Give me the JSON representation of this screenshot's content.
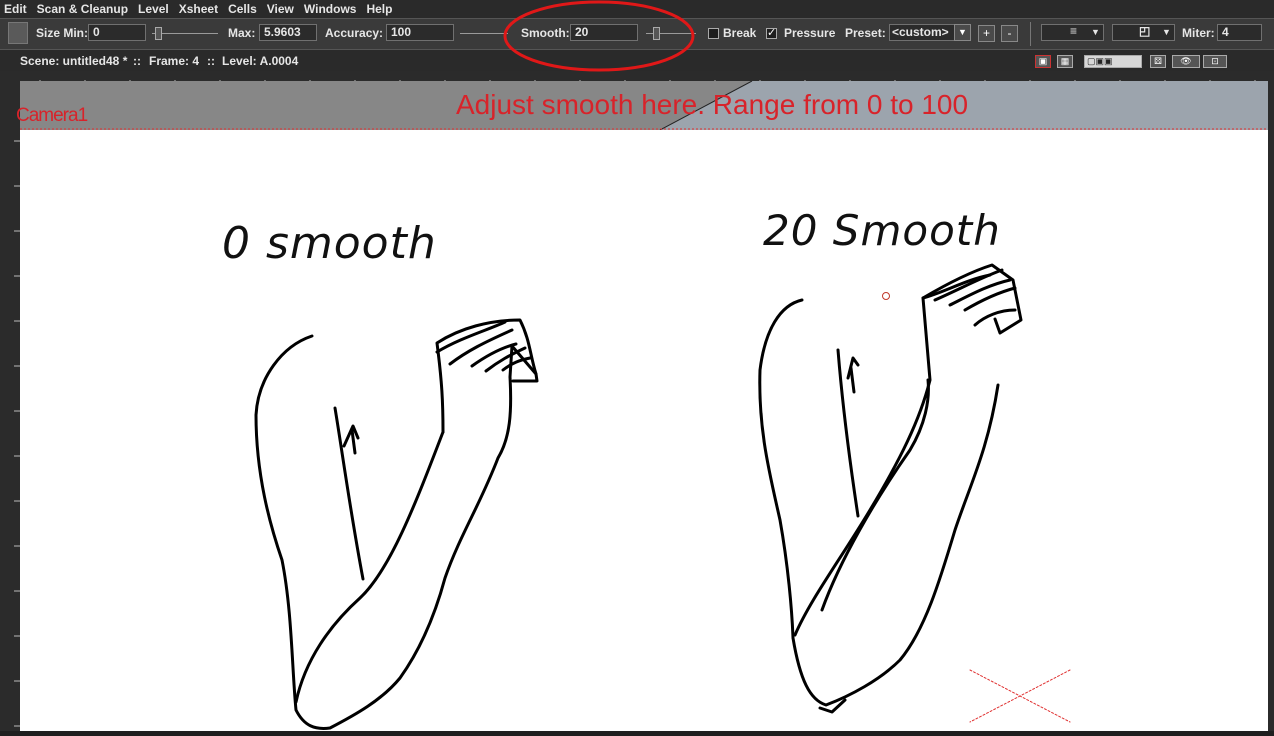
{
  "menu": [
    "Edit",
    "Scan & Cleanup",
    "Level",
    "Xsheet",
    "Cells",
    "View",
    "Windows",
    "Help"
  ],
  "toolbar": {
    "size_min_label": "Size Min:",
    "size_min_value": "0",
    "max_label": "Max:",
    "max_value": "5.9603",
    "accuracy_label": "Accuracy:",
    "accuracy_value": "100",
    "smooth_label": "Smooth:",
    "smooth_value": "20",
    "break_label": "Break",
    "pressure_label": "Pressure",
    "preset_label": "Preset:",
    "preset_value": "<custom>",
    "plus_label": "+",
    "minus_label": "-",
    "miter_label": "Miter:",
    "miter_value": "4"
  },
  "status": {
    "scene": "Scene: untitled48 *",
    "sep1": "::",
    "frame": "Frame: 4",
    "sep2": "::",
    "level": "Level: A.0004"
  },
  "viewer": {
    "camera_label": "Camera1",
    "annotation": "Adjust smooth here. Range from 0 to 100"
  },
  "drawing": {
    "left_caption": "0 smooth",
    "right_caption": "20 Smooth"
  },
  "colors": {
    "annotation_red": "#d8232a",
    "ellipse_red": "#e01818",
    "camera_strip_left": "#8a8a8a",
    "camera_strip_right": "#9aa4ae"
  }
}
